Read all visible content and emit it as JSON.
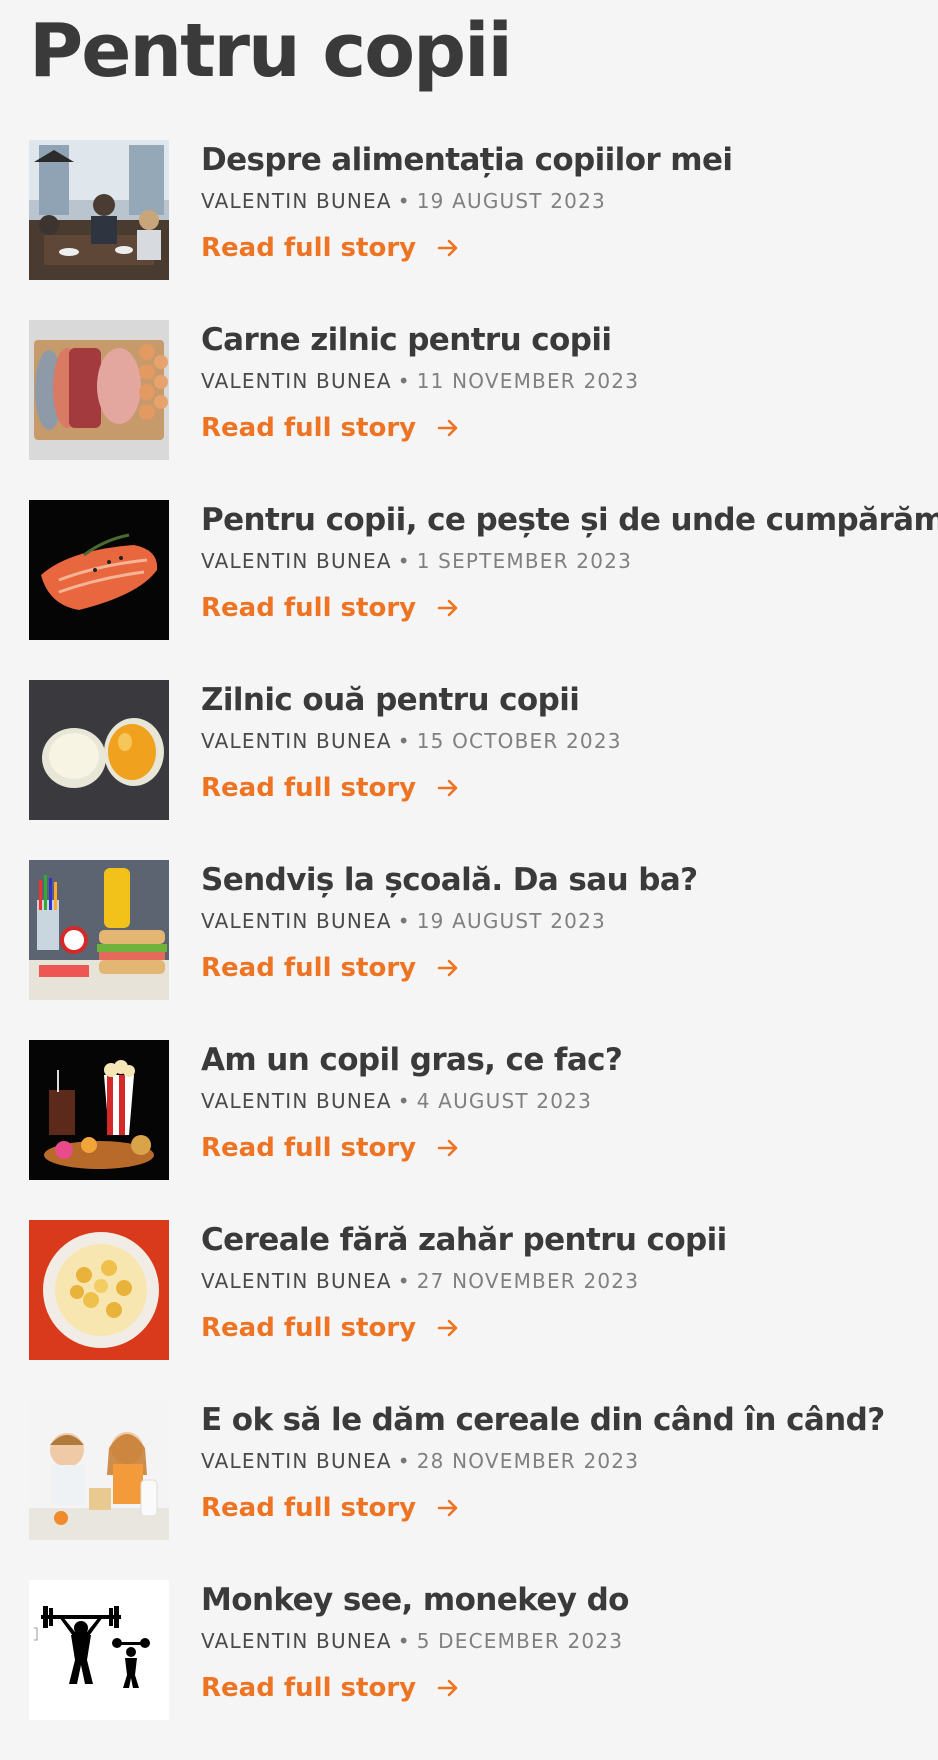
{
  "page": {
    "title": "Pentru copii"
  },
  "accent_color": "#ee7424",
  "articles": [
    {
      "title": "Despre alimentația copiilor mei",
      "author": "VALENTIN BUNEA",
      "separator": "•",
      "date": "19 AUGUST 2023",
      "read_more": "Read full story",
      "image_icon": "family-dinner-image"
    },
    {
      "title": "Carne zilnic pentru copii",
      "author": "VALENTIN BUNEA",
      "separator": "•",
      "date": "11 NOVEMBER 2023",
      "read_more": "Read full story",
      "image_icon": "meat-eggs-image"
    },
    {
      "title": "Pentru copii, ce pește și de unde cumpărăm?",
      "author": "VALENTIN BUNEA",
      "separator": "•",
      "date": "1 SEPTEMBER 2023",
      "read_more": "Read full story",
      "image_icon": "salmon-fillet-image"
    },
    {
      "title": "Zilnic ouă pentru copii",
      "author": "VALENTIN BUNEA",
      "separator": "•",
      "date": "15 OCTOBER 2023",
      "read_more": "Read full story",
      "image_icon": "cracked-egg-image"
    },
    {
      "title": "Sendviș la școală. Da sau ba?",
      "author": "VALENTIN BUNEA",
      "separator": "•",
      "date": "19 AUGUST 2023",
      "read_more": "Read full story",
      "image_icon": "school-sandwich-image"
    },
    {
      "title": "Am un copil gras, ce fac?",
      "author": "VALENTIN BUNEA",
      "separator": "•",
      "date": "4 AUGUST 2023",
      "read_more": "Read full story",
      "image_icon": "junk-food-image"
    },
    {
      "title": "Cereale fără zahăr pentru copii",
      "author": "VALENTIN BUNEA",
      "separator": "•",
      "date": "27 NOVEMBER 2023",
      "read_more": "Read full story",
      "image_icon": "cereal-bowl-image"
    },
    {
      "title": "E ok să le dăm cereale din când în când?",
      "author": "VALENTIN BUNEA",
      "separator": "•",
      "date": "28 NOVEMBER 2023",
      "read_more": "Read full story",
      "image_icon": "kids-breakfast-image"
    },
    {
      "title": "Monkey see, monekey do",
      "author": "VALENTIN BUNEA",
      "separator": "•",
      "date": "5 DECEMBER 2023",
      "read_more": "Read full story",
      "image_icon": "weightlifters-image"
    }
  ]
}
